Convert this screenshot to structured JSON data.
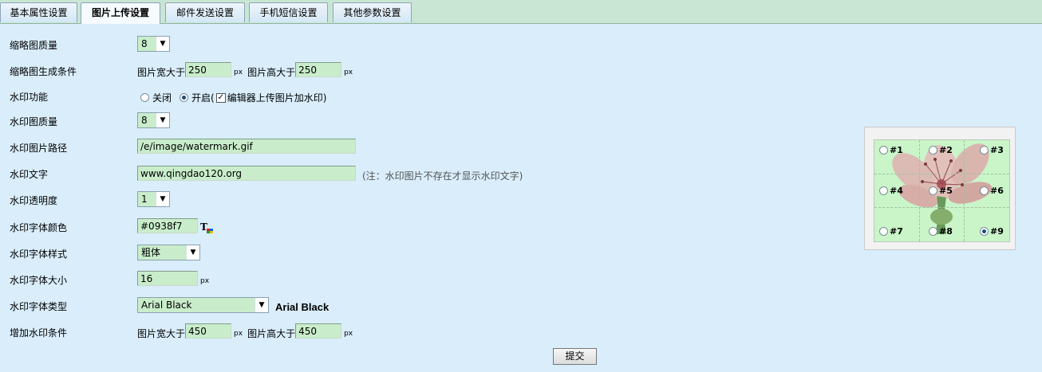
{
  "tabs": [
    {
      "label": "基本属性设置",
      "active": false
    },
    {
      "label": "图片上传设置",
      "active": true
    },
    {
      "label": "邮件发送设置",
      "active": false
    },
    {
      "label": "手机短信设置",
      "active": false
    },
    {
      "label": "其他参数设置",
      "active": false
    }
  ],
  "form": {
    "thumb_quality": {
      "label": "缩略图质量",
      "value": "8"
    },
    "thumb_condition": {
      "label": "缩略图生成条件",
      "width_prefix": "图片宽大于",
      "width_value": "250",
      "width_unit": "px",
      "height_prefix": "图片高大于",
      "height_value": "250",
      "height_unit": "px"
    },
    "watermark_function": {
      "label": "水印功能",
      "option_off": "关闭",
      "option_on": "开启(",
      "selected": "on",
      "editor_checkbox_label": "编辑器上传图片加水印)",
      "editor_checked": true
    },
    "watermark_quality": {
      "label": "水印图质量",
      "value": "8"
    },
    "watermark_path": {
      "label": "水印图片路径",
      "value": "/e/image/watermark.gif"
    },
    "watermark_text": {
      "label": "水印文字",
      "value": "www.qingdao120.org",
      "note": "(注：水印图片不存在才显示水印文字)"
    },
    "watermark_opacity": {
      "label": "水印透明度",
      "value": "1"
    },
    "font_color": {
      "label": "水印字体颜色",
      "value": "#0938f7"
    },
    "font_style": {
      "label": "水印字体样式",
      "value": "粗体"
    },
    "font_size": {
      "label": "水印字体大小",
      "value": "16",
      "unit": "px"
    },
    "font_type": {
      "label": "水印字体类型",
      "value": "Arial Black",
      "preview": "Arial Black"
    },
    "add_condition": {
      "label": "增加水印条件",
      "width_prefix": "图片宽大于",
      "width_value": "450",
      "width_unit": "px",
      "height_prefix": "图片高大于",
      "height_value": "450",
      "height_unit": "px"
    }
  },
  "submit_label": "提交",
  "positions": {
    "labels": [
      "#1",
      "#2",
      "#3",
      "#4",
      "#5",
      "#6",
      "#7",
      "#8",
      "#9"
    ],
    "selected": "#9"
  },
  "icons": {
    "color_picker": "text-color-icon"
  }
}
